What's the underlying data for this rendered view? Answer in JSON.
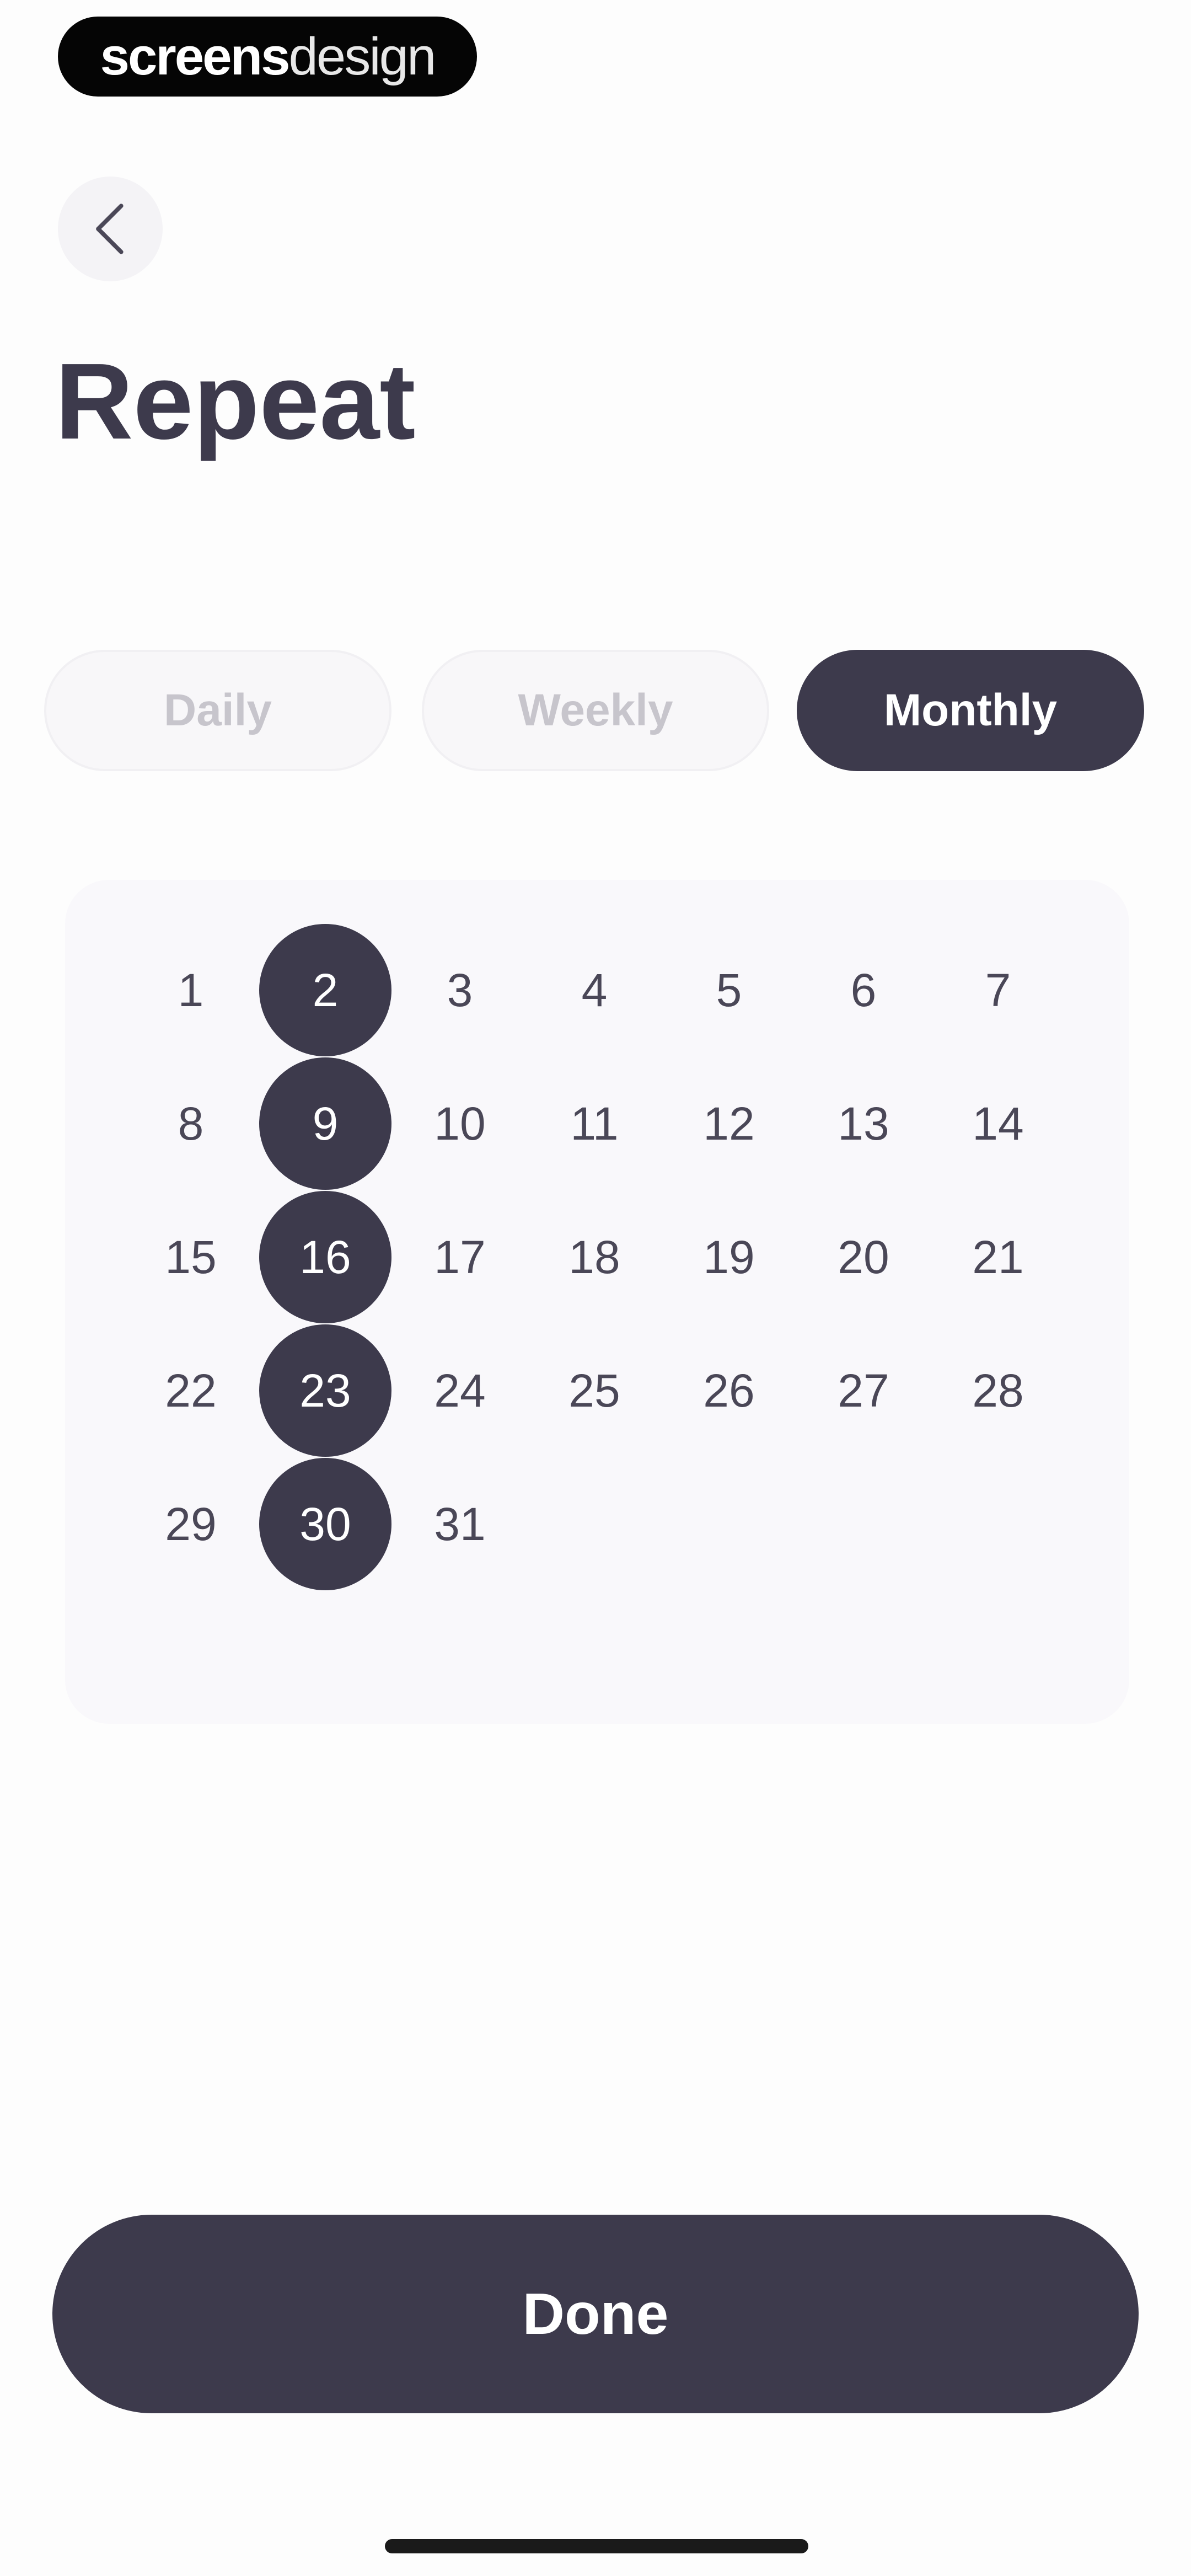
{
  "brand": {
    "strong": "screens",
    "light": "design"
  },
  "header": {
    "back_icon": "chevron-left-icon",
    "title": "Repeat"
  },
  "repeat_modes": [
    {
      "label": "Daily",
      "active": false
    },
    {
      "label": "Weekly",
      "active": false
    },
    {
      "label": "Monthly",
      "active": true
    }
  ],
  "calendar": {
    "days": [
      "1",
      "2",
      "3",
      "4",
      "5",
      "6",
      "7",
      "8",
      "9",
      "10",
      "11",
      "12",
      "13",
      "14",
      "15",
      "16",
      "17",
      "18",
      "19",
      "20",
      "21",
      "22",
      "23",
      "24",
      "25",
      "26",
      "27",
      "28",
      "29",
      "30",
      "31"
    ],
    "selected": [
      "2",
      "9",
      "16",
      "23",
      "30"
    ]
  },
  "footer": {
    "done_label": "Done"
  },
  "colors": {
    "primary": "#3d3a4c",
    "background": "#fdfdfd",
    "card": "#f9f8fb",
    "inactive_text": "#c7c5cc"
  }
}
